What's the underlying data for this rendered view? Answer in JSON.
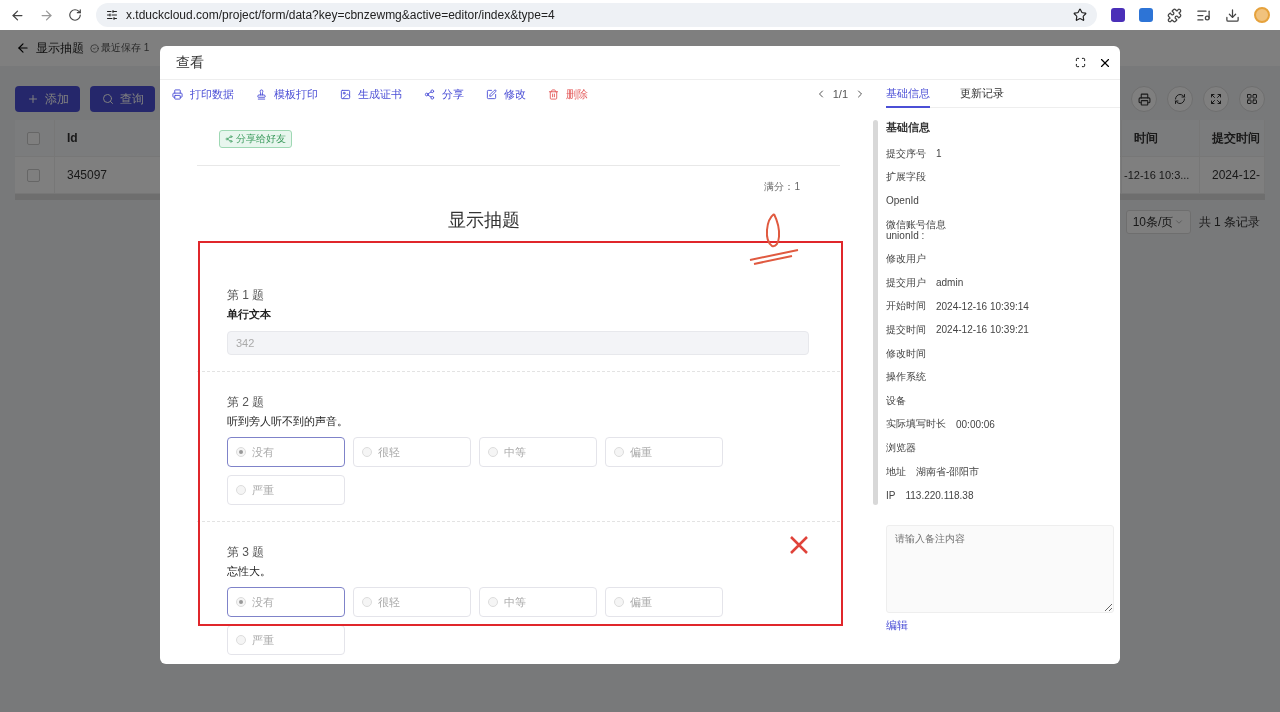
{
  "browser": {
    "url": "x.tduckcloud.com/project/form/data?key=cbnzewmg&active=editor/index&type=4"
  },
  "page": {
    "title": "显示抽题",
    "save_status": "最近保存 1",
    "buttons": [
      {
        "label": "添加",
        "kind": "add"
      },
      {
        "label": "查询",
        "kind": "search"
      }
    ],
    "table": {
      "all_checked": false,
      "columns": [
        "Id",
        "时间",
        "提交时间"
      ],
      "rows": [
        {
          "cells": [
            "345097",
            "-12-16 10:3...",
            "2024-12-"
          ],
          "checked": false
        }
      ]
    },
    "pagination": {
      "page_size": "10条/页",
      "total": "共 1 条记录"
    }
  },
  "modal": {
    "title": "查看",
    "actions": [
      {
        "label": "打印数据",
        "kind": "print"
      },
      {
        "label": "模板打印",
        "kind": "template"
      },
      {
        "label": "生成证书",
        "kind": "certificate"
      },
      {
        "label": "分享",
        "kind": "share"
      },
      {
        "label": "修改",
        "kind": "edit"
      },
      {
        "label": "删除",
        "kind": "delete"
      }
    ],
    "pager": "1/1",
    "share_button": "分享给好友",
    "full_score": "满分：1",
    "form_title": "显示抽题",
    "questions": [
      {
        "number": "第 1 题",
        "title": "单行文本",
        "bold": true,
        "kind": "text",
        "value": "342"
      },
      {
        "number": "第 2 题",
        "title": "听到旁人听不到的声音。",
        "bold": false,
        "kind": "choice",
        "options": [
          {
            "label": "没有",
            "selected": true
          },
          {
            "label": "很轻",
            "selected": false
          },
          {
            "label": "中等",
            "selected": false
          },
          {
            "label": "偏重",
            "selected": false
          },
          {
            "label": "严重",
            "selected": false
          }
        ]
      },
      {
        "number": "第 3 题",
        "title": "忘性大。",
        "bold": false,
        "kind": "choice",
        "options": [
          {
            "label": "没有",
            "selected": true
          },
          {
            "label": "很轻",
            "selected": false
          },
          {
            "label": "中等",
            "selected": false
          },
          {
            "label": "偏重",
            "selected": false
          },
          {
            "label": "严重",
            "selected": false
          }
        ]
      }
    ],
    "tabs": [
      {
        "label": "基础信息",
        "selected": true
      },
      {
        "label": "更新记录",
        "selected": false
      }
    ],
    "info_title": "基础信息",
    "info": [
      {
        "label": "提交序号",
        "value": "1"
      },
      {
        "label": "扩展字段"
      },
      {
        "label": "OpenId"
      },
      {
        "label": "微信账号信息",
        "sub": "unionId :"
      },
      {
        "label": "修改用户"
      },
      {
        "label": "提交用户",
        "value": "admin"
      },
      {
        "label": "开始时间",
        "value": "2024-12-16 10:39:14"
      },
      {
        "label": "提交时间",
        "value": "2024-12-16 10:39:21"
      },
      {
        "label": "修改时间"
      },
      {
        "label": "操作系统"
      },
      {
        "label": "设备"
      },
      {
        "label": "实际填写时长",
        "value": "00:00:06"
      },
      {
        "label": "浏览器"
      },
      {
        "label": "地址",
        "value": "湖南省-邵阳市"
      },
      {
        "label": "IP",
        "value": "113.220.118.38"
      }
    ],
    "remark_placeholder": "请输入备注内容",
    "edit_link": "编辑"
  }
}
